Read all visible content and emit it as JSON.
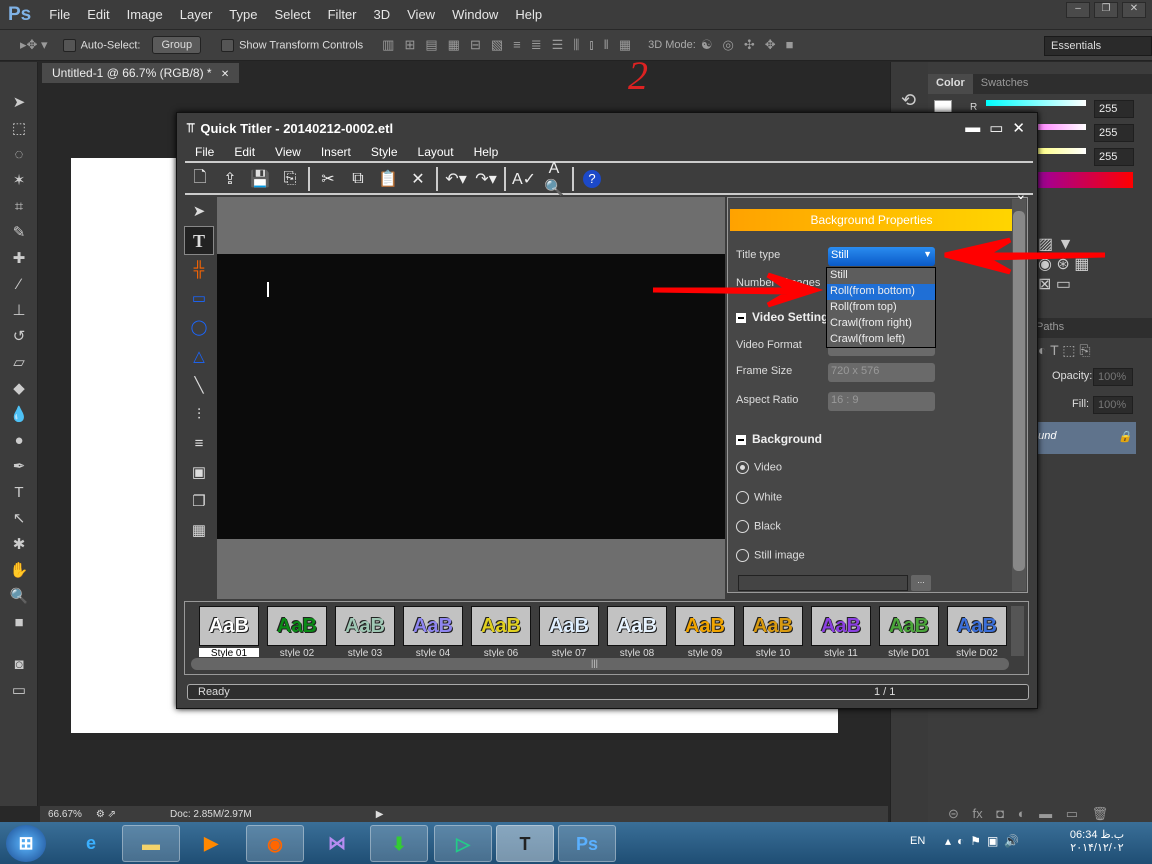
{
  "ps": {
    "logo": "Ps",
    "menu": [
      "File",
      "Edit",
      "Image",
      "Layer",
      "Type",
      "Select",
      "Filter",
      "3D",
      "View",
      "Window",
      "Help"
    ],
    "options": {
      "auto_select": "Auto-Select:",
      "group": "Group",
      "show_transform": "Show Transform Controls",
      "mode3d": "3D Mode:",
      "workspace": "Essentials"
    },
    "doc_tab": "Untitled-1 @ 66.7% (RGB/8) *",
    "status": {
      "zoom": "66.67%",
      "doc": "Doc: 2.85M/2.97M"
    },
    "color_panel": {
      "tabs": [
        "Color",
        "Swatches"
      ],
      "r": "255",
      "g": "255",
      "b": "255",
      "r_label": "R"
    },
    "layers": {
      "tab": "Paths",
      "opacity_label": "Opacity:",
      "opacity": "100%",
      "fill_label": "Fill:",
      "fill": "100%",
      "layer": "ound"
    }
  },
  "annotation": "2",
  "titler": {
    "title": "Quick Titler - 20140212-0002.etl",
    "menu": [
      "File",
      "Edit",
      "View",
      "Insert",
      "Style",
      "Layout",
      "Help"
    ],
    "props": {
      "header": "Background Properties",
      "title_type_label": "Title type",
      "title_type": "Still",
      "num_pages_label": "Number of pages",
      "video_settings": "Video Setting",
      "video_format_label": "Video Format",
      "frame_size_label": "Frame Size",
      "frame_size": "720 x 576",
      "aspect_label": "Aspect Ratio",
      "aspect": "16 : 9",
      "background": "Background",
      "bg_options": [
        "Video",
        "White",
        "Black",
        "Still image"
      ],
      "bg_selected": "Video",
      "browse": "...",
      "dropdown_options": [
        "Still",
        "Roll(from bottom)",
        "Roll(from top)",
        "Crawl(from right)",
        "Crawl(from left)"
      ],
      "dropdown_highlight": "Roll(from bottom)"
    },
    "styles": [
      {
        "name": "Style 01",
        "color": "#ffffff"
      },
      {
        "name": "style 02",
        "color": "#0a8a16"
      },
      {
        "name": "style 03",
        "color": "#9fc7b4"
      },
      {
        "name": "style 04",
        "color": "#8f86f0"
      },
      {
        "name": "style 06",
        "color": "#e0d020"
      },
      {
        "name": "style 07",
        "color": "#dfefff"
      },
      {
        "name": "style 08",
        "color": "#e8f4ff"
      },
      {
        "name": "style 09",
        "color": "#f0a400"
      },
      {
        "name": "style 10",
        "color": "#d89a10"
      },
      {
        "name": "style 11",
        "color": "#8a40e0"
      },
      {
        "name": "style D01",
        "color": "#4aa43a"
      },
      {
        "name": "style D02",
        "color": "#3b6fd8"
      }
    ],
    "styles_sample": "AaB",
    "status": "Ready",
    "page": "1 / 1"
  },
  "taskbar": {
    "lang": "EN",
    "time": "06:34 ب.ظ",
    "date": "۲۰۱۴/۱۲/۰۲"
  },
  "colors": {
    "accent_blue": "#1f6fd6",
    "arrow_red": "#ff0000",
    "header_orange": "#ffa200"
  }
}
